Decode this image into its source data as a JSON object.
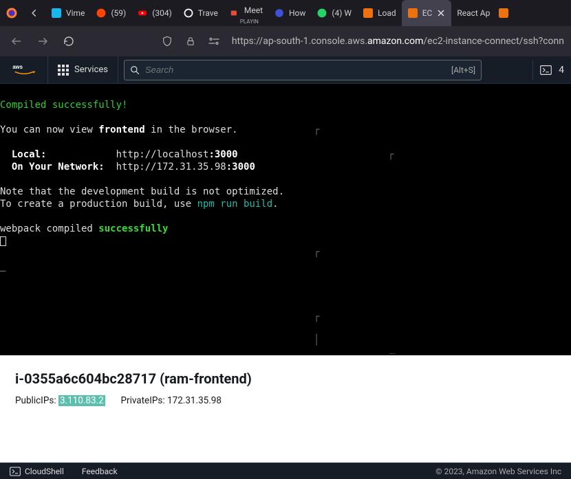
{
  "tabs": [
    {
      "title": "Vime"
    },
    {
      "title": "(59)"
    },
    {
      "title": "(304)"
    },
    {
      "title": "Trave"
    },
    {
      "title": "Meet",
      "subtitle": "PLAYIN"
    },
    {
      "title": "How"
    },
    {
      "title": "(4) W"
    },
    {
      "title": "Load"
    },
    {
      "title": "EC",
      "active": true
    },
    {
      "title": "React Ap"
    }
  ],
  "url": {
    "prefix": "https://ap-south-1.console.aws.",
    "domain": "amazon.com",
    "suffix": "/ec2-instance-connect/ssh?conn"
  },
  "aws": {
    "services_label": "Services",
    "search_placeholder": "Search",
    "search_kbd": "[Alt+S]"
  },
  "terminal": {
    "line1": "Compiled successfully!",
    "line2a": "You can now view ",
    "line2b": "frontend",
    "line2c": " in the browser.",
    "local_label": "Local:",
    "local_url_a": "http://localhost",
    "local_url_b": ":3000",
    "net_label": "On Your Network:",
    "net_url_a": "http://172.31.35.98",
    "net_url_b": ":3000",
    "note1": "Note that the development build is not optimized.",
    "note2a": "To create a production build, use ",
    "note2b": "npm run build",
    "note2c": ".",
    "wp_a": "webpack compiled ",
    "wp_b": "successfully"
  },
  "info": {
    "instance_id": "i-0355a6c604bc28717",
    "instance_name": "(ram-frontend)",
    "public_label": "PublicIPs:",
    "public_ip": "3.110.83.2",
    "private_label": "PrivateIPs:",
    "private_ip": "172.31.35.98"
  },
  "footer": {
    "cloudshell": "CloudShell",
    "feedback": "Feedback",
    "copyright": "© 2023, Amazon Web Services Inc"
  }
}
